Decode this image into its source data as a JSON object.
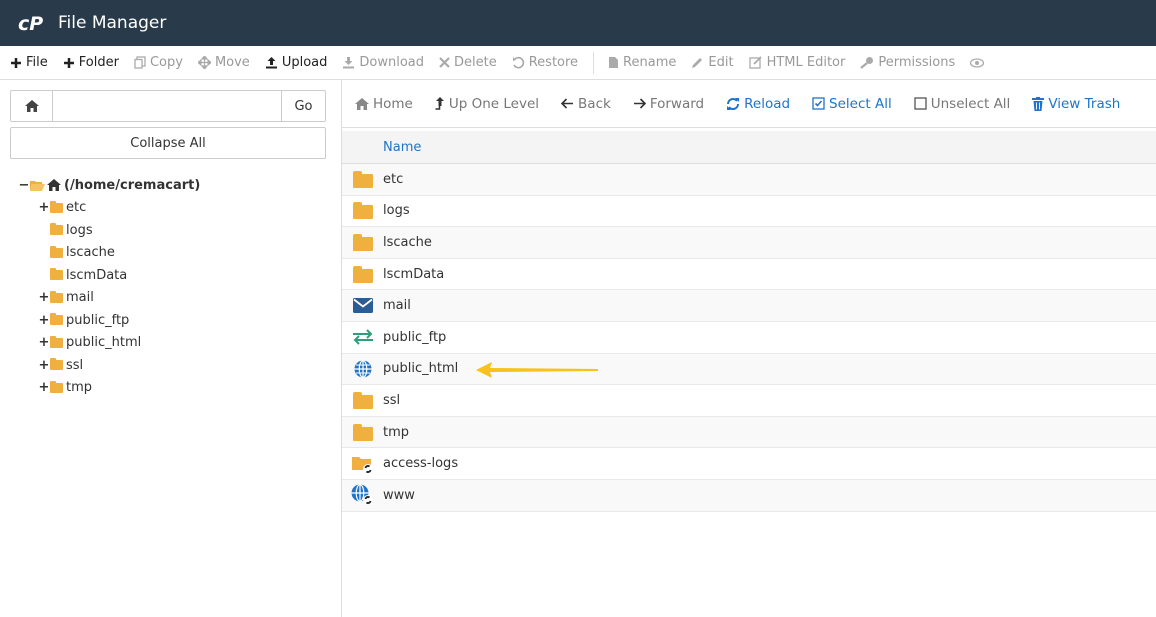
{
  "app": {
    "title": "File Manager"
  },
  "toolbar": {
    "items": [
      {
        "label": "File",
        "icon": "plus-icon",
        "active": true
      },
      {
        "label": "Folder",
        "icon": "plus-icon",
        "active": true
      },
      {
        "label": "Copy",
        "icon": "copy-icon",
        "active": false
      },
      {
        "label": "Move",
        "icon": "move-icon",
        "active": false
      },
      {
        "label": "Upload",
        "icon": "upload-icon",
        "active": true
      },
      {
        "label": "Download",
        "icon": "download-icon",
        "active": false
      },
      {
        "label": "Delete",
        "icon": "delete-icon",
        "active": false
      },
      {
        "label": "Restore",
        "icon": "restore-icon",
        "active": false
      },
      {
        "label": "Rename",
        "icon": "rename-icon",
        "active": false
      },
      {
        "label": "Edit",
        "icon": "pencil-icon",
        "active": false
      },
      {
        "label": "HTML Editor",
        "icon": "html-editor-icon",
        "active": false
      },
      {
        "label": "Permissions",
        "icon": "key-icon",
        "active": false
      }
    ]
  },
  "left": {
    "search_value": "",
    "go_label": "Go",
    "collapse_label": "Collapse All",
    "tree_root": "(/home/cremacart)",
    "tree": [
      {
        "label": "etc",
        "toggle": "+"
      },
      {
        "label": "logs",
        "toggle": ""
      },
      {
        "label": "lscache",
        "toggle": ""
      },
      {
        "label": "lscmData",
        "toggle": ""
      },
      {
        "label": "mail",
        "toggle": "+"
      },
      {
        "label": "public_ftp",
        "toggle": "+"
      },
      {
        "label": "public_html",
        "toggle": "+"
      },
      {
        "label": "ssl",
        "toggle": "+"
      },
      {
        "label": "tmp",
        "toggle": "+"
      }
    ]
  },
  "nav": {
    "items": [
      {
        "label": "Home",
        "icon": "home-icon",
        "color": "#777777"
      },
      {
        "label": "Up One Level",
        "icon": "level-up-icon",
        "color": "#777777"
      },
      {
        "label": "Back",
        "icon": "back-arrow-icon",
        "color": "#777777"
      },
      {
        "label": "Forward",
        "icon": "forward-arrow-icon",
        "color": "#777777"
      },
      {
        "label": "Reload",
        "icon": "reload-icon",
        "color": "#1f74c9"
      },
      {
        "label": "Select All",
        "icon": "checkbox-checked-icon",
        "color": "#1f74c9"
      },
      {
        "label": "Unselect All",
        "icon": "checkbox-empty-icon",
        "color": "#777777"
      },
      {
        "label": "View Trash",
        "icon": "trash-icon",
        "color": "#1f74c9"
      }
    ]
  },
  "table": {
    "header_name": "Name",
    "rows": [
      {
        "name": "etc",
        "icon": "folder-icon"
      },
      {
        "name": "logs",
        "icon": "folder-icon"
      },
      {
        "name": "lscache",
        "icon": "folder-icon"
      },
      {
        "name": "lscmData",
        "icon": "folder-icon"
      },
      {
        "name": "mail",
        "icon": "mail-icon"
      },
      {
        "name": "public_ftp",
        "icon": "ftp-transfer-icon"
      },
      {
        "name": "public_html",
        "icon": "globe-icon"
      },
      {
        "name": "ssl",
        "icon": "folder-icon"
      },
      {
        "name": "tmp",
        "icon": "folder-icon"
      },
      {
        "name": "access-logs",
        "icon": "folder-link-icon"
      },
      {
        "name": "www",
        "icon": "globe-link-icon"
      }
    ]
  },
  "colors": {
    "titlebar": "#293a4a",
    "accent": "#1f74c9",
    "folder": "#f0b03e",
    "highlight_arrow": "#f7c21a"
  }
}
